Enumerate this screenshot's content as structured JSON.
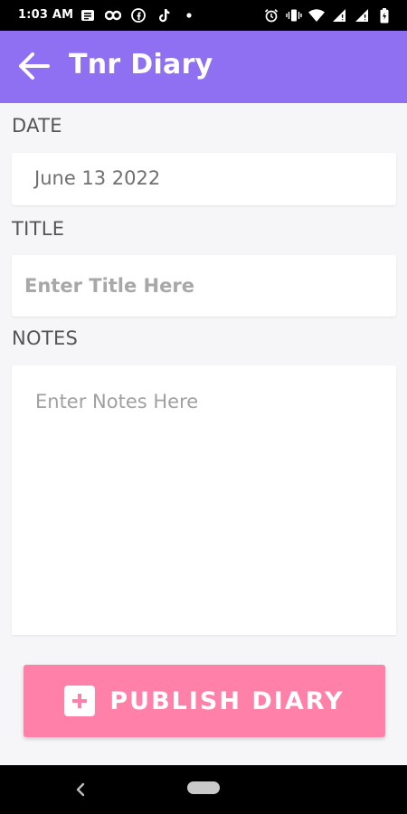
{
  "status_bar": {
    "time": "1:03 AM",
    "left_icons": [
      "message-icon",
      "link-icon",
      "facebook-icon",
      "tiktok-icon",
      "dot-icon"
    ],
    "right_icons": [
      "alarm-icon",
      "vibrate-icon",
      "wifi-icon",
      "signal-icon",
      "signal-icon",
      "battery-icon"
    ]
  },
  "app_bar": {
    "title": "Tnr Diary",
    "back_icon": "arrow-left-icon",
    "color": "#8f6ff2"
  },
  "form": {
    "date": {
      "label": "DATE",
      "value": "June 13 2022"
    },
    "title": {
      "label": "TITLE",
      "placeholder": "Enter Title Here"
    },
    "notes": {
      "label": "NOTES",
      "placeholder": "Enter Notes Here"
    }
  },
  "publish": {
    "label": "PUBLISH DIARY",
    "icon": "plus-square-icon",
    "color": "#ff80a8"
  },
  "nav_bar": {
    "icons": [
      "back-chevron-icon",
      "home-pill-icon"
    ]
  }
}
